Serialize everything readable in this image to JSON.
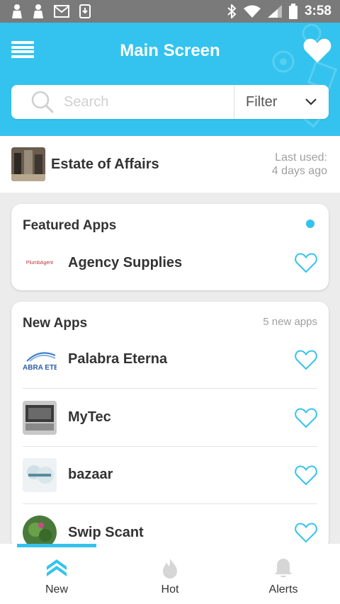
{
  "status_bar": {
    "time": "3:58"
  },
  "header": {
    "title": "Main Screen",
    "search_placeholder": "Search",
    "filter_label": "Filter",
    "accent": "#33c3ee"
  },
  "recent": {
    "name": "Estate of Affairs",
    "time_line1": "Last used:",
    "time_line2": "4 days ago"
  },
  "featured": {
    "title": "Featured Apps",
    "apps": [
      {
        "name": "Agency Supplies",
        "logo_text": "PlumbAgent"
      }
    ]
  },
  "new_apps": {
    "title": "New Apps",
    "meta": "5 new apps",
    "apps": [
      {
        "name": "Palabra Eterna",
        "logo_text": "ABRA ETE"
      },
      {
        "name": "MyTec"
      },
      {
        "name": "bazaar"
      },
      {
        "name": "Swip Scant"
      }
    ]
  },
  "nav": {
    "tabs": [
      {
        "label": "New",
        "icon": "chevrons-up-icon",
        "active": true
      },
      {
        "label": "Hot",
        "icon": "flame-icon",
        "active": false
      },
      {
        "label": "Alerts",
        "icon": "bell-icon",
        "active": false
      }
    ]
  }
}
